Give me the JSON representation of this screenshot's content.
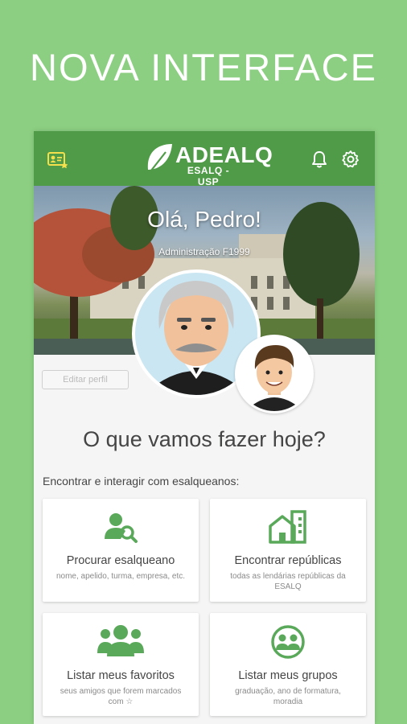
{
  "promo": {
    "title": "NOVA INTERFACE"
  },
  "app": {
    "brand": "ADEALQ",
    "brand_sub": "ESALQ - USP",
    "icons": {
      "profile_card": "id-card-icon",
      "notifications": "bell-icon",
      "settings": "gear-icon"
    }
  },
  "profile": {
    "greeting": "Olá, Pedro!",
    "course": "Administração F1999",
    "edit_label": "Editar perfil"
  },
  "main": {
    "question": "O que vamos fazer hoje?",
    "section_label": "Encontrar e interagir com esalqueanos:",
    "cards": [
      {
        "title": "Procurar esalqueano",
        "desc": "nome, apelido, turma, empresa, etc.",
        "icon": "user-search-icon"
      },
      {
        "title": "Encontrar repúblicas",
        "desc": "todas as lendárias repúblicas da ESALQ",
        "icon": "buildings-icon"
      },
      {
        "title": "Listar meus favoritos",
        "desc": "seus amigos que forem marcados com ☆",
        "icon": "users-group-icon"
      },
      {
        "title": "Listar meus grupos",
        "desc": "graduação, ano de formatura, moradia",
        "icon": "group-circle-icon"
      }
    ]
  },
  "colors": {
    "background": "#8ccf82",
    "appbar": "#4f9b47",
    "icon_green": "#5aa95a",
    "accent_yellow": "#f4e04d"
  }
}
